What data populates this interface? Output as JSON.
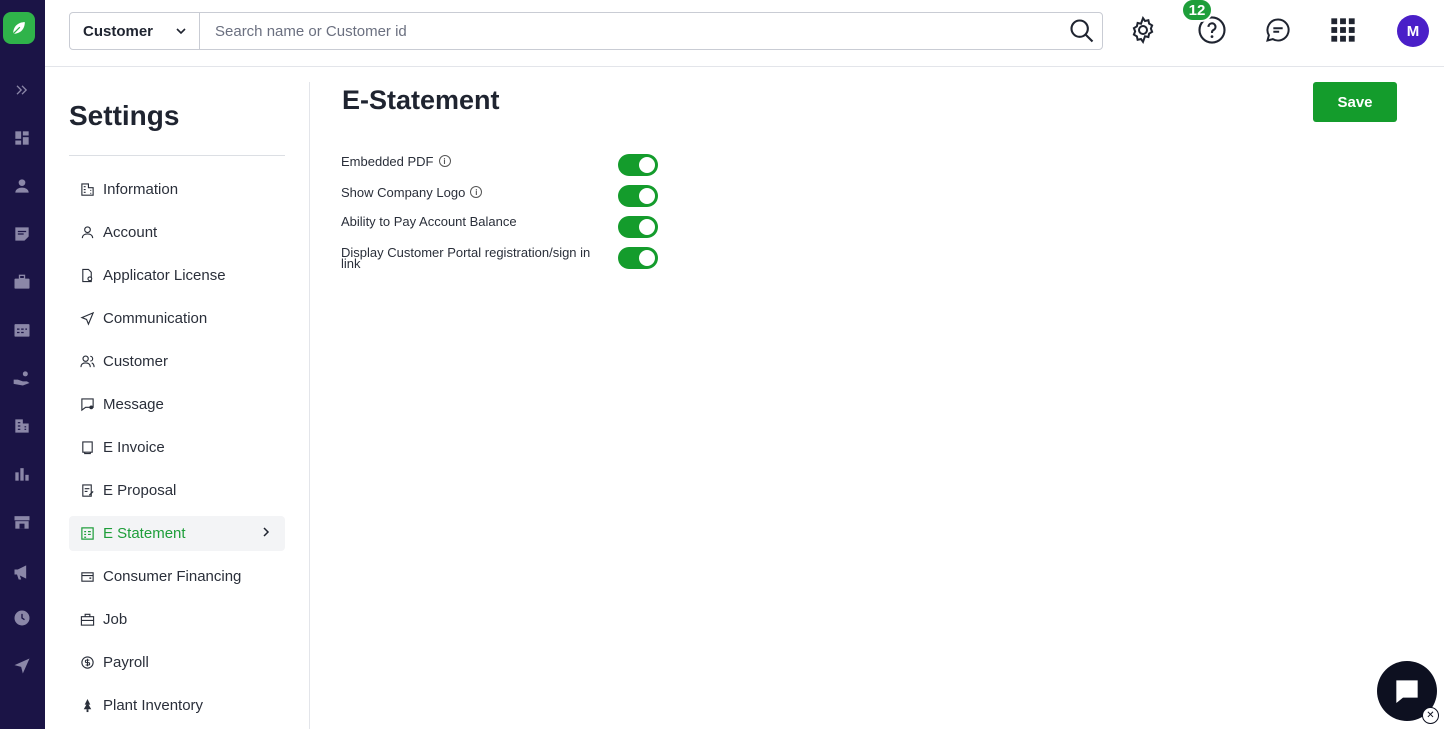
{
  "rail": {
    "icons": [
      "leaf-logo-icon",
      "expand-icon",
      "dashboard-icon",
      "person-icon",
      "notes-icon",
      "briefcase-icon",
      "calendar-icon",
      "hand-coin-icon",
      "building-icon",
      "bar-chart-icon",
      "store-icon",
      "megaphone-icon",
      "clock-icon",
      "send-icon"
    ]
  },
  "topbar": {
    "scope_label": "Customer",
    "search_placeholder": "Search name or Customer id",
    "help_badge": "12",
    "avatar_initial": "M"
  },
  "settings": {
    "title": "Settings",
    "items": [
      {
        "label": "Information",
        "icon": "building-icon",
        "active": false
      },
      {
        "label": "Account",
        "icon": "user-icon",
        "active": false
      },
      {
        "label": "Applicator License",
        "icon": "license-icon",
        "active": false
      },
      {
        "label": "Communication",
        "icon": "send-icon",
        "active": false
      },
      {
        "label": "Customer",
        "icon": "users-icon",
        "active": false
      },
      {
        "label": "Message",
        "icon": "message-icon",
        "active": false
      },
      {
        "label": "E Invoice",
        "icon": "invoice-icon",
        "active": false
      },
      {
        "label": "E Proposal",
        "icon": "proposal-icon",
        "active": false
      },
      {
        "label": "E Statement",
        "icon": "statement-icon",
        "active": true
      },
      {
        "label": "Consumer Financing",
        "icon": "wallet-icon",
        "active": false
      },
      {
        "label": "Job",
        "icon": "briefcase-icon",
        "active": false
      },
      {
        "label": "Payroll",
        "icon": "payroll-icon",
        "active": false
      },
      {
        "label": "Plant Inventory",
        "icon": "plant-icon",
        "active": false
      }
    ]
  },
  "main": {
    "title": "E-Statement",
    "save_label": "Save",
    "options": [
      {
        "label": "Embedded PDF",
        "info": true,
        "enabled": true
      },
      {
        "label": "Show Company Logo",
        "info": true,
        "enabled": true
      },
      {
        "label": "Ability to Pay Account Balance",
        "info": false,
        "enabled": true
      },
      {
        "label": "Display Customer Portal registration/sign in link",
        "info": false,
        "enabled": true
      }
    ]
  },
  "colors": {
    "rail_bg": "#1b1446",
    "accent_green": "#149c2c",
    "avatar_purple": "#4a1fc8"
  }
}
